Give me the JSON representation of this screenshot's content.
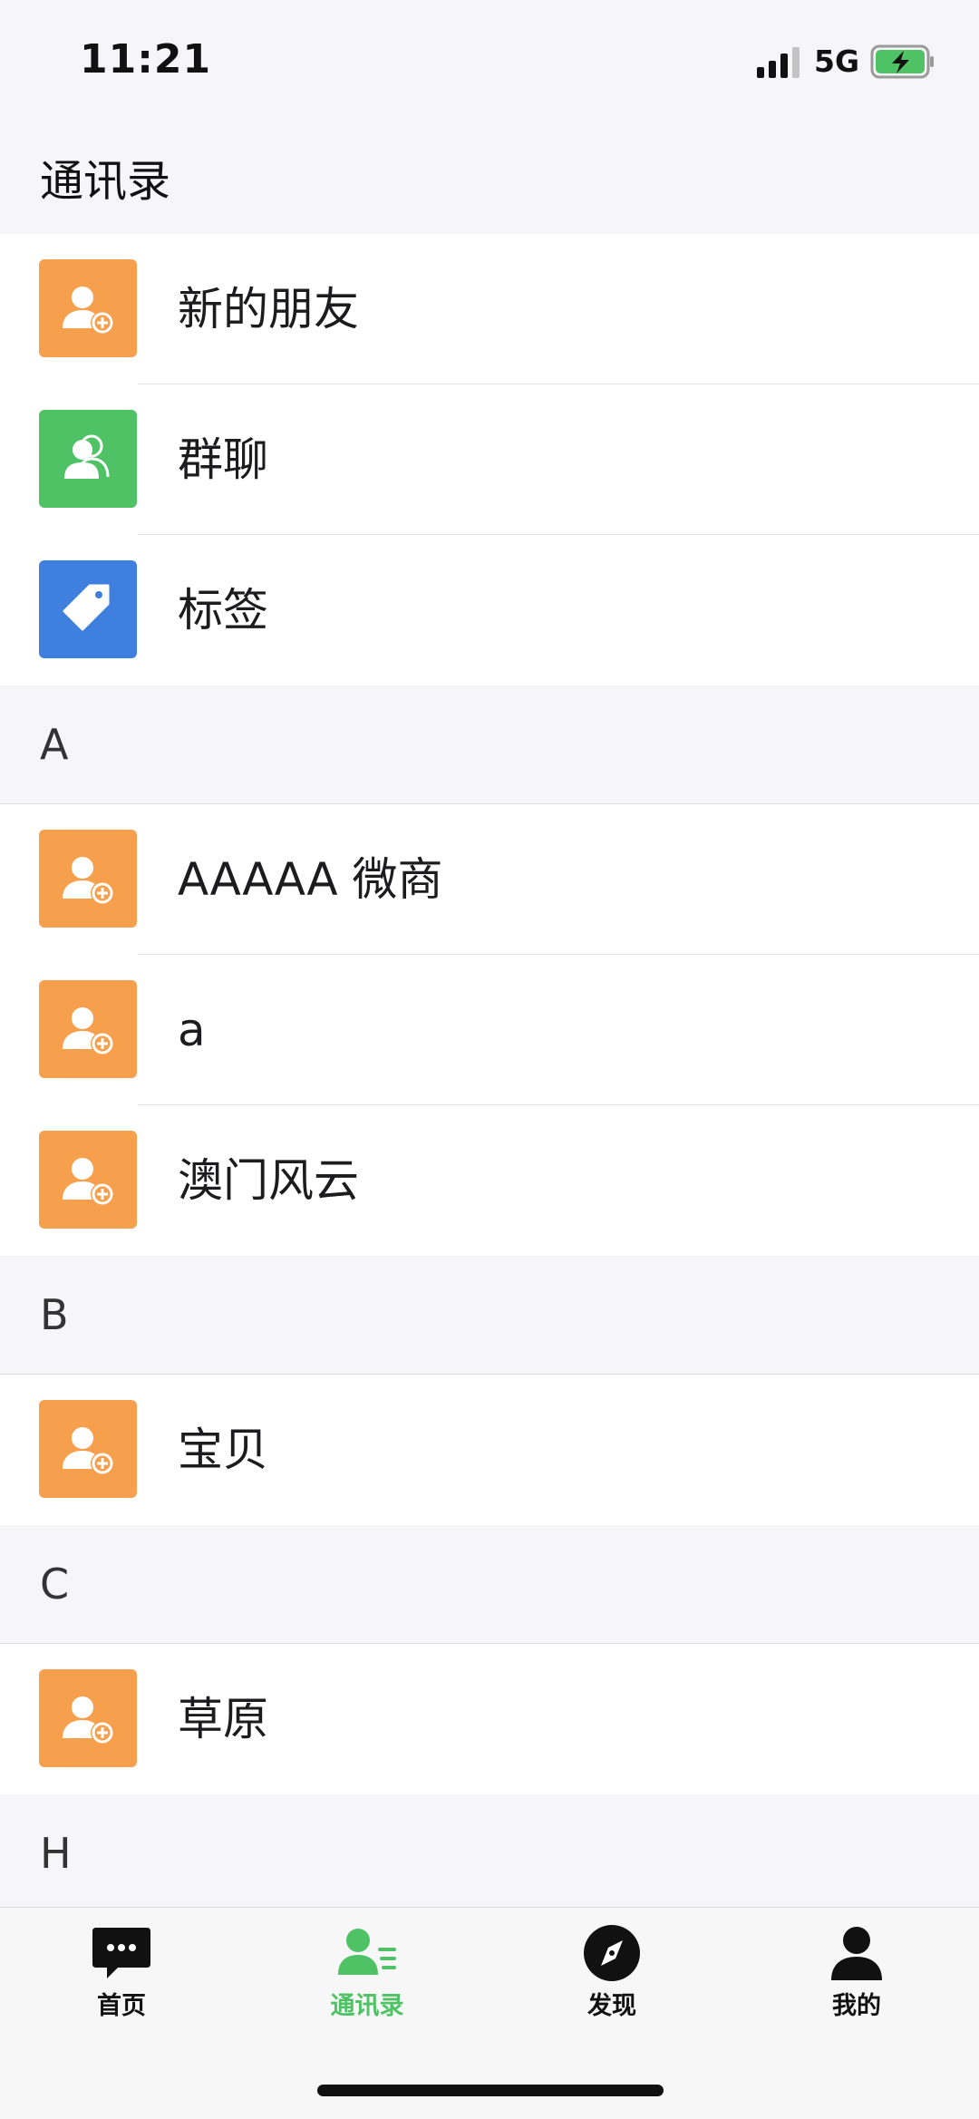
{
  "status_bar": {
    "time": "11:21",
    "network": "5G",
    "battery_charging": true
  },
  "header": {
    "title": "通讯录"
  },
  "list": [
    {
      "type": "row",
      "label": "新的朋友",
      "icon": "add-friend-icon",
      "color": "#f6a04d"
    },
    {
      "type": "row",
      "label": "群聊",
      "icon": "group-chat-icon",
      "color": "#4fc266"
    },
    {
      "type": "row",
      "label": "标签",
      "icon": "tag-icon",
      "color": "#3f80df"
    },
    {
      "type": "section",
      "label": "A"
    },
    {
      "type": "row",
      "label": "AAAAA 微商",
      "icon": "contact-avatar-icon",
      "color": "#f6a04d"
    },
    {
      "type": "row",
      "label": "a",
      "icon": "contact-avatar-icon",
      "color": "#f6a04d"
    },
    {
      "type": "row",
      "label": "澳门风云",
      "icon": "contact-avatar-icon",
      "color": "#f6a04d"
    },
    {
      "type": "section",
      "label": "B"
    },
    {
      "type": "row",
      "label": "宝贝",
      "icon": "contact-avatar-icon",
      "color": "#f6a04d"
    },
    {
      "type": "section",
      "label": "C"
    },
    {
      "type": "row",
      "label": "草原",
      "icon": "contact-avatar-icon",
      "color": "#f6a04d"
    },
    {
      "type": "section",
      "label": "H"
    }
  ],
  "tab_bar": {
    "tabs": [
      {
        "label": "首页",
        "icon": "chat-bubble-icon",
        "active": false
      },
      {
        "label": "通讯录",
        "icon": "contacts-icon",
        "active": true
      },
      {
        "label": "发现",
        "icon": "compass-icon",
        "active": false
      },
      {
        "label": "我的",
        "icon": "profile-icon",
        "active": false
      }
    ],
    "active_color": "#4fc266"
  }
}
